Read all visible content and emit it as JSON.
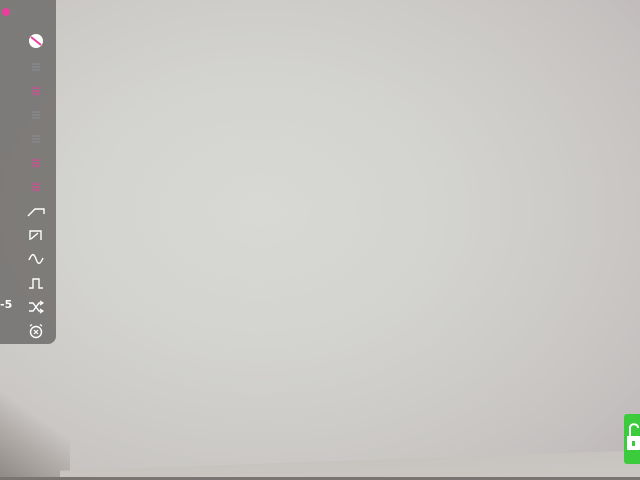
{
  "camera": {
    "scene": "ceiling"
  },
  "panel": {
    "value_label": "-5",
    "buttons": [
      {
        "name": "no-pattern-icon",
        "color": "#ffffff"
      },
      {
        "name": "lines-icon-1",
        "color": "#8a8f98"
      },
      {
        "name": "pink-lines-icon-1",
        "color": "#e83f9c"
      },
      {
        "name": "lines-icon-2",
        "color": "#8a8f98"
      },
      {
        "name": "lines-icon-3",
        "color": "#8a8f98"
      },
      {
        "name": "pink-lines-icon-2",
        "color": "#e83f9c"
      },
      {
        "name": "pink-lines-icon-3",
        "color": "#e83f9c"
      },
      {
        "name": "ramp-wave-icon",
        "color": "#ffffff"
      },
      {
        "name": "sawtooth-wave-icon",
        "color": "#ffffff"
      },
      {
        "name": "sine-wave-icon",
        "color": "#ffffff"
      },
      {
        "name": "square-wave-icon",
        "color": "#ffffff"
      },
      {
        "name": "shuffle-icon",
        "color": "#ffffff"
      },
      {
        "name": "alarm-icon",
        "color": "#ffffff"
      }
    ]
  },
  "colors": {
    "accent": "#e83f9c",
    "lock": "#3ccb3c",
    "panel": "#767472"
  }
}
